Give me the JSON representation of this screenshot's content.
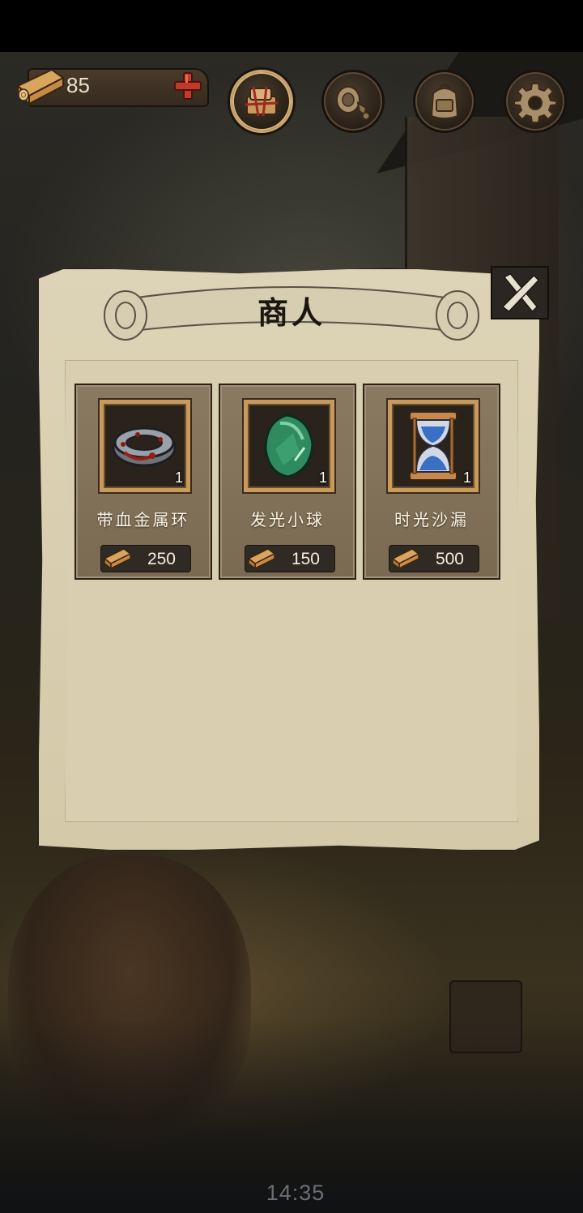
{
  "resources": {
    "wood_count": "85",
    "add_icon": "plus-icon",
    "wood_icon": "wood-log-icon"
  },
  "top_buttons": [
    {
      "icon": "supplies-bundle-icon",
      "active": true
    },
    {
      "icon": "horn-icon",
      "active": false
    },
    {
      "icon": "backpack-icon",
      "active": false
    },
    {
      "icon": "gear-icon",
      "active": false
    }
  ],
  "dialog": {
    "title": "商人",
    "close_icon": "close-x-icon",
    "items": [
      {
        "name": "带血金属环",
        "quantity": "1",
        "price": "250",
        "icon": "bloody-metal-ring-icon"
      },
      {
        "name": "发光小球",
        "quantity": "1",
        "price": "150",
        "icon": "glowing-orb-icon"
      },
      {
        "name": "时光沙漏",
        "quantity": "1",
        "price": "500",
        "icon": "hourglass-icon"
      }
    ]
  },
  "clock": "14:35",
  "colors": {
    "accent_gold": "#c89a5c",
    "parchment": "#d9cfb0",
    "plus_red": "#c0392b"
  }
}
